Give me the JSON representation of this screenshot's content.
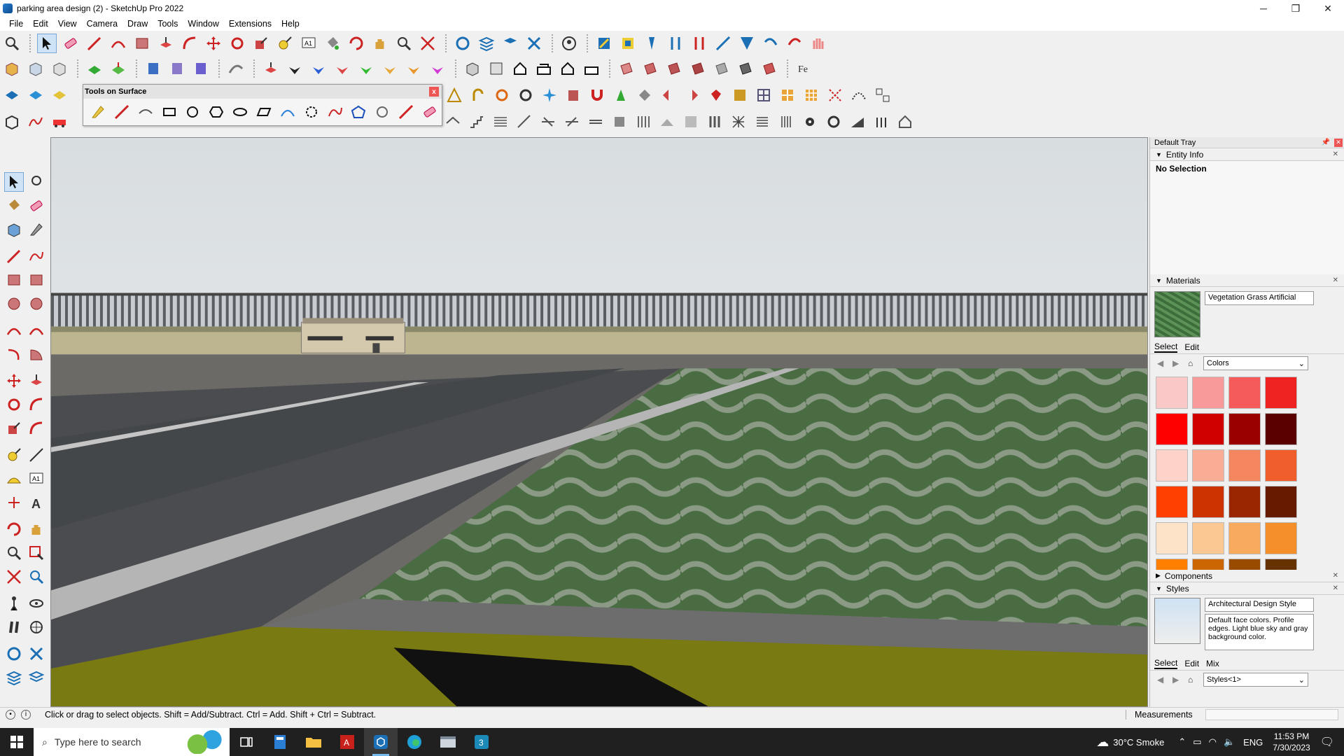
{
  "window": {
    "title": "parking area design (2) - SketchUp Pro 2022",
    "minimize": "─",
    "maximize": "❐",
    "close": "✕"
  },
  "menu": [
    "File",
    "Edit",
    "View",
    "Camera",
    "Draw",
    "Tools",
    "Window",
    "Extensions",
    "Help"
  ],
  "floating_toolbar": {
    "title": "Tools on Surface",
    "close": "x"
  },
  "tray": {
    "title": "Default Tray",
    "entity_info": {
      "header": "Entity Info",
      "selection": "No Selection"
    },
    "materials": {
      "header": "Materials",
      "current_material": "Vegetation Grass Artificial",
      "tabs": [
        "Select",
        "Edit"
      ],
      "library": "Colors",
      "swatches": [
        "#fbc8c8",
        "#f99a9a",
        "#f55b5b",
        "#f02323",
        "#ff0000",
        "#d00000",
        "#9a0000",
        "#5a0000",
        "#fdd2c8",
        "#f9ad95",
        "#f4875f",
        "#f05e2c",
        "#ff4000",
        "#cc3300",
        "#992600",
        "#661a00",
        "#fde3c8",
        "#fbc793",
        "#f8aa5e",
        "#f58f29",
        "#ff8000",
        "#cc6600",
        "#994c00",
        "#663300"
      ]
    },
    "components": {
      "header": "Components"
    },
    "styles": {
      "header": "Styles",
      "current_style": "Architectural Design Style",
      "description": "Default face colors. Profile edges. Light blue sky and gray background color.",
      "tabs": [
        "Select",
        "Edit",
        "Mix"
      ],
      "library": "Styles<1>"
    }
  },
  "statusbar": {
    "hint": "Click or drag to select objects. Shift = Add/Subtract. Ctrl = Add. Shift + Ctrl = Subtract.",
    "measurements_label": "Measurements"
  },
  "taskbar": {
    "search_placeholder": "Type here to search",
    "weather": "30°C  Smoke",
    "language": "ENG",
    "time": "11:53 PM",
    "date": "7/30/2023"
  },
  "colors": {
    "toolbar_bg": "#f0f0f0",
    "sky_top": "#d9dee1",
    "sky_bottom": "#eef0f0",
    "asphalt": "#4a4c4f",
    "lane_line": "#b5b5b5",
    "grass": "#4d7043",
    "yellow_curb": "#7a7a12",
    "taskbar": "#202020"
  }
}
